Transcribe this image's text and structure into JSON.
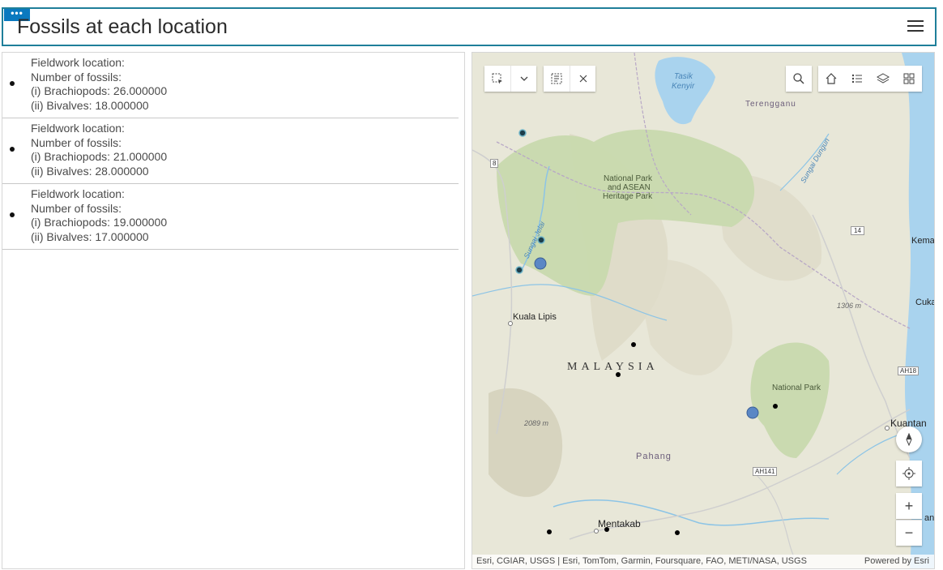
{
  "header": {
    "title": "Fossils at each location",
    "options_glyph": "•••",
    "menu_icon": "hamburger-menu-icon"
  },
  "list": {
    "items": [
      {
        "location_label": "Fieldwork location:",
        "count_label": "Number of fossils:",
        "brachiopods": "(i) Brachiopods: 26.000000",
        "bivalves": "(ii) Bivalves: 18.000000"
      },
      {
        "location_label": "Fieldwork location:",
        "count_label": "Number of fossils:",
        "brachiopods": "(i) Brachiopods: 21.000000",
        "bivalves": "(ii) Bivalves: 28.000000"
      },
      {
        "location_label": "Fieldwork location:",
        "count_label": "Number of fossils:",
        "brachiopods": "(i) Brachiopods: 19.000000",
        "bivalves": "(ii) Bivalves: 17.000000"
      }
    ]
  },
  "map": {
    "labels": {
      "tasik": "Tasik",
      "kenyir": "Kenyir",
      "terengganu": "Terengganu",
      "national_park_1": "National Park",
      "national_park_2": "and ASEAN",
      "national_park_3": "Heritage Park",
      "sungai_dungun": "Sungai Dungun",
      "sungai_tembeling": "Sungai Jelai",
      "kuala_lipis": "Kuala Lipis",
      "malaysia": "MALAYSIA",
      "pahang": "Pahang",
      "national_park_east": "National Park",
      "kuantan": "Kuantan",
      "kemaman": "Kema",
      "cukai": "Cuka",
      "mentakab": "Mentakab",
      "elev_1306": "1306 m",
      "elev_2089": "2089 m",
      "route_8": "8",
      "route_14": "14",
      "route_ah18": "AH18",
      "route_ah141": "AH141",
      "route_an": "an"
    },
    "attribution_left": "Esri, CGIAR, USGS | Esri, TomTom, Garmin, Foursquare, FAO, METI/NASA, USGS",
    "attribution_right": "Powered by Esri",
    "zoom_in": "+",
    "zoom_out": "−",
    "colors": {
      "water": "#a9d3ee",
      "park": "#c8d9ae",
      "terrain": "#e7e6d6",
      "point_blue": "#5a87c5",
      "point_dark": "#1d3d4a",
      "header_border": "#1f7f9a",
      "options_button": "#0a79bf"
    }
  }
}
